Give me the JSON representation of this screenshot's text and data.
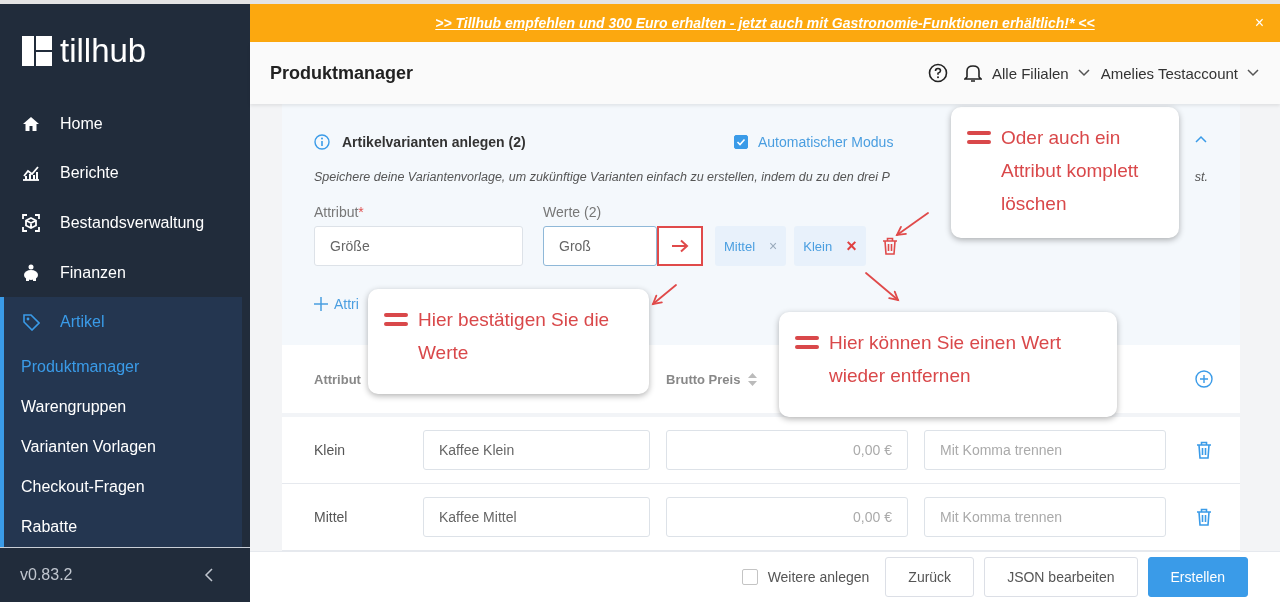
{
  "sidebar": {
    "logo": "tillhub",
    "items": [
      {
        "label": "Home",
        "selected": false
      },
      {
        "label": "Berichte",
        "selected": false
      },
      {
        "label": "Bestandsverwaltung",
        "selected": false
      },
      {
        "label": "Finanzen",
        "selected": false
      },
      {
        "label": "Artikel",
        "selected": true,
        "expanded": true,
        "children": [
          {
            "label": "Produktmanager",
            "selected": true
          },
          {
            "label": "Warengruppen",
            "selected": false
          },
          {
            "label": "Varianten Vorlagen",
            "selected": false
          },
          {
            "label": "Checkout-Fragen",
            "selected": false
          },
          {
            "label": "Rabatte",
            "selected": false
          }
        ]
      }
    ],
    "version": "v0.83.2"
  },
  "banner": {
    "text": ">> Tillhub empfehlen und 300 Euro erhalten - jetzt auch mit Gastronomie-Funktionen erhältlich!* <<",
    "close": "×"
  },
  "header": {
    "title": "Produktmanager",
    "branch": "Alle Filialen",
    "account": "Amelies Testaccount"
  },
  "card": {
    "title": "Artikelvarianten anlegen (2)",
    "auto_mode": {
      "label": "Automatischer Modus",
      "checked": true
    },
    "expanded": true,
    "description_start": "Speichere deine Variantenvorlage, um zukünftige Varianten einfach zu erstellen, indem du zu den drei P",
    "description_end": "st.",
    "attribute_field": {
      "label": "Attribut",
      "required_mark": "*",
      "value": "Größe"
    },
    "values_field": {
      "label": "Werte (2)",
      "value": "Groß"
    },
    "tags": [
      {
        "label": "Mittel",
        "remove": "×",
        "highlighted": false
      },
      {
        "label": "Klein",
        "remove": "×",
        "highlighted": true
      }
    ],
    "add_attribute": "Attri"
  },
  "table": {
    "columns": [
      {
        "label": "Attribut",
        "sortable": false
      },
      {
        "label": "Brutto Preis",
        "sortable": true
      }
    ],
    "rows": [
      {
        "attribute": "Klein",
        "name": "Kaffee Klein",
        "price_placeholder": "0,00 €",
        "tags_placeholder": "Mit Komma trennen"
      },
      {
        "attribute": "Mittel",
        "name": "Kaffee Mittel",
        "price_placeholder": "0,00 €",
        "tags_placeholder": "Mit Komma trennen"
      }
    ]
  },
  "footer": {
    "more": {
      "label": "Weitere anlegen",
      "checked": false
    },
    "buttons": [
      {
        "label": "Zurück",
        "kind": "default"
      },
      {
        "label": "JSON bearbeiten",
        "kind": "default"
      },
      {
        "label": "Erstellen",
        "kind": "primary"
      }
    ]
  },
  "callouts": [
    {
      "text": "Oder auch ein Attribut komplett löschen"
    },
    {
      "text": "Hier bestätigen Sie die Werte"
    },
    {
      "text": "Hier können Sie einen Wert wieder entfernen"
    }
  ]
}
